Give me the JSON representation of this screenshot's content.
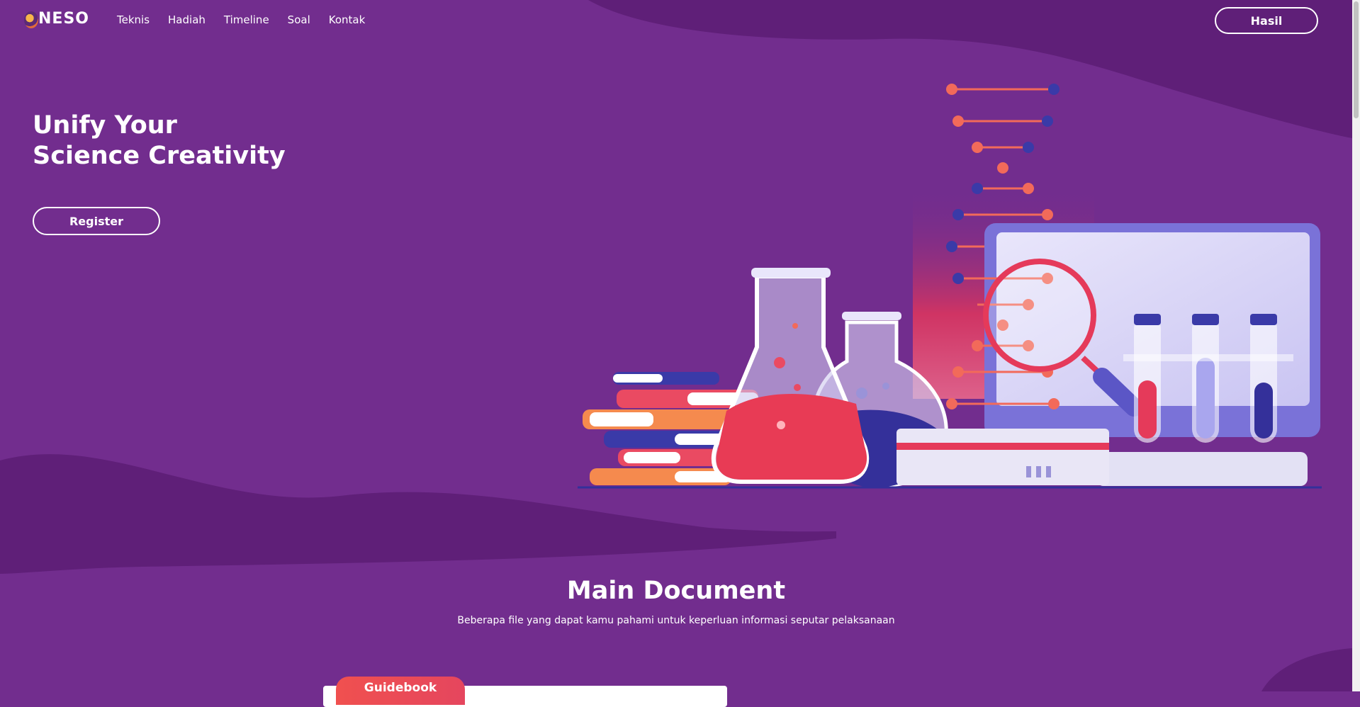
{
  "nav": {
    "logo_text": "NESO",
    "links": [
      "Teknis",
      "Hadiah",
      "Timeline",
      "Soal",
      "Kontak"
    ],
    "hasil_label": "Hasil"
  },
  "hero": {
    "title_line1": "Unify Your",
    "title_line2": "Science Creativity",
    "register_label": "Register"
  },
  "documents": {
    "title": "Main Document",
    "subtitle": "Beberapa file yang dapat kamu pahami untuk keperluan informasi seputar pelaksanaan",
    "tab_label": "Guidebook"
  },
  "colors": {
    "background": "#722d8e",
    "wave_dark": "#5f1f78",
    "accent_red": "#f0504f",
    "accent_blue": "#3a3aa8"
  },
  "icons": {
    "logo": "neso-logo-icon",
    "illustration": "science-lab-illustration"
  }
}
